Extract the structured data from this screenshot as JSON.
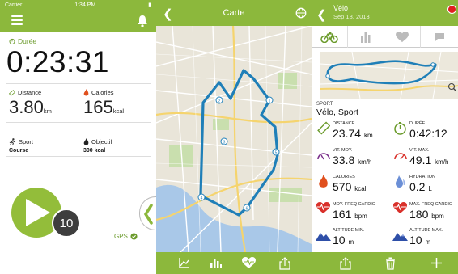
{
  "screen1": {
    "status": {
      "carrier": "Carrier",
      "time": "1:34 PM"
    },
    "duration": {
      "label": "Durée",
      "value": "0:23:31"
    },
    "distance": {
      "label": "Distance",
      "value": "3.80",
      "unit": "km"
    },
    "calories": {
      "label": "Calories",
      "value": "165",
      "unit": "kcal"
    },
    "sport": {
      "label": "Sport",
      "value": "Course"
    },
    "objective": {
      "label": "Objectif",
      "value": "300 kcal"
    },
    "counter": "10",
    "gps_label": "GPS"
  },
  "screen2": {
    "title": "Carte",
    "toolbar_icons": [
      "chart-icon",
      "bars-icon",
      "heart-icon",
      "share-icon"
    ],
    "markers": [
      "1",
      "2",
      "3",
      "4",
      "5",
      "6"
    ]
  },
  "screen3": {
    "title": "Vélo",
    "date": "Sep 18, 2013",
    "tabs": [
      "bike-icon",
      "bars-icon",
      "heart-icon",
      "comment-icon"
    ],
    "sport_label": "SPORT",
    "sport_value": "Vélo, Sport",
    "stats": {
      "distance": {
        "label": "DISTANCE",
        "value": "23.74",
        "unit": "km"
      },
      "duration": {
        "label": "DURÉE",
        "value": "0:42:12",
        "unit": ""
      },
      "avg_speed": {
        "label": "VIT. MOY.",
        "value": "33.8",
        "unit": "km/h"
      },
      "max_speed": {
        "label": "VIT. MAX.",
        "value": "49.1",
        "unit": "km/h"
      },
      "calories": {
        "label": "CALORIES",
        "value": "570",
        "unit": "kcal"
      },
      "hydration": {
        "label": "HYDRATION",
        "value": "0.2",
        "unit": "L"
      },
      "avg_hr": {
        "label": "MOY. FREQ CARDIO",
        "value": "161",
        "unit": "bpm"
      },
      "max_hr": {
        "label": "MAX. FREQ CARDIO",
        "value": "180",
        "unit": "bpm"
      },
      "alt_min": {
        "label": "ALTITUDE MIN.",
        "value": "10",
        "unit": "m"
      },
      "alt_max": {
        "label": "ALTITUDE MAX.",
        "value": "10",
        "unit": "m"
      }
    },
    "toolbar_icons": [
      "share-icon",
      "trash-icon",
      "add-icon"
    ]
  },
  "colors": {
    "brand_green": "#8cb83c",
    "route_blue": "#2a8fc5",
    "heart_red": "#d9302a"
  }
}
